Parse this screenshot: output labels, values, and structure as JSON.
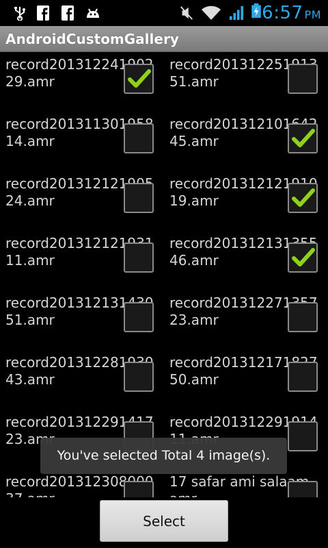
{
  "status_bar": {
    "icons": [
      "usb-icon",
      "facebook-icon",
      "facebook-icon",
      "android-debug-icon",
      "mute-icon",
      "wifi-icon",
      "signal-icon",
      "battery-charging-icon"
    ],
    "time": "6:57",
    "ampm": "PM"
  },
  "title": "AndroidCustomGallery",
  "colors": {
    "accent": "#2fa7e6",
    "check": "#8ed21a",
    "titlebar": "#8a8a8a"
  },
  "items": [
    {
      "name": "record20131224190229.amr",
      "checked": true
    },
    {
      "name": "record20131225191351.amr",
      "checked": false
    },
    {
      "name": "record20131130195814.amr",
      "checked": false
    },
    {
      "name": "record20131210164245.amr",
      "checked": true
    },
    {
      "name": "record20131212190524.amr",
      "checked": false
    },
    {
      "name": "record20131212191019.amr",
      "checked": true
    },
    {
      "name": "record20131212193111.amr",
      "checked": false
    },
    {
      "name": "record20131213135546.amr",
      "checked": true
    },
    {
      "name": "record20131213143051.amr",
      "checked": false
    },
    {
      "name": "record20131227135723.amr",
      "checked": false
    },
    {
      "name": "record20131228193043.amr",
      "checked": false
    },
    {
      "name": "record20131217182750.amr",
      "checked": false
    },
    {
      "name": "record20131229141723.amr",
      "checked": false
    },
    {
      "name": "record20131229191411.amr",
      "checked": false
    },
    {
      "name": "record20131230800037.amr",
      "checked": false
    },
    {
      "name": "17 safar ami salaam.amr",
      "checked": false
    }
  ],
  "toast": "You've selected Total 4 image(s).",
  "button": {
    "label": "Select"
  }
}
